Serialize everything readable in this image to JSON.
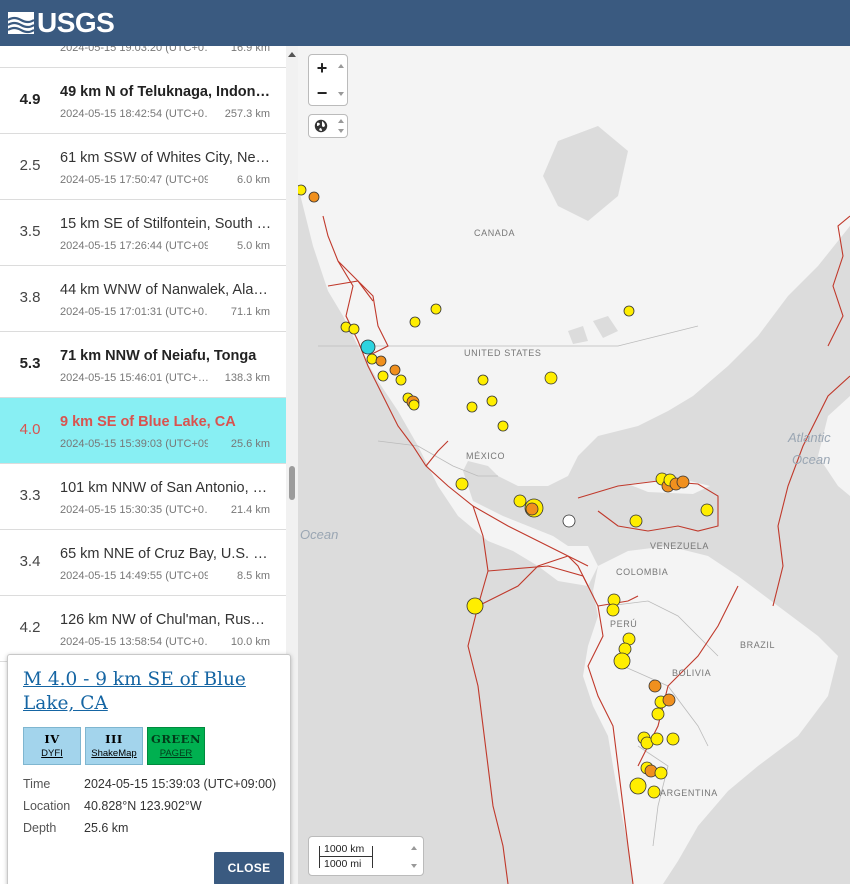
{
  "header": {
    "logo_text": "USGS"
  },
  "list": {
    "items": [
      {
        "mag": "",
        "place": "",
        "time": "2024-05-15 19:03:20 (UTC+0…",
        "depth": "16.9 km",
        "bold": false,
        "selected": false,
        "partial": true
      },
      {
        "mag": "4.9",
        "place": "49 km N of Teluknaga, Indon…",
        "time": "2024-05-15 18:42:54 (UTC+0…",
        "depth": "257.3 km",
        "bold": true,
        "selected": false
      },
      {
        "mag": "2.5",
        "place": "61 km SSW of Whites City, Ne…",
        "time": "2024-05-15 17:50:47 (UTC+09:…",
        "depth": "6.0 km",
        "bold": false,
        "selected": false
      },
      {
        "mag": "3.5",
        "place": "15 km SE of Stilfontein, South …",
        "time": "2024-05-15 17:26:44 (UTC+09:…",
        "depth": "5.0 km",
        "bold": false,
        "selected": false
      },
      {
        "mag": "3.8",
        "place": "44 km WNW of Nanwalek, Ala…",
        "time": "2024-05-15 17:01:31 (UTC+0…",
        "depth": "71.1 km",
        "bold": false,
        "selected": false
      },
      {
        "mag": "5.3",
        "place": "71 km NNW of Neiafu, Tonga",
        "time": "2024-05-15 15:46:01 (UTC+…",
        "depth": "138.3 km",
        "bold": true,
        "selected": false
      },
      {
        "mag": "4.0",
        "place": "9 km SE of Blue Lake, CA",
        "time": "2024-05-15 15:39:03 (UTC+09:00)",
        "depth": "25.6 km",
        "bold": false,
        "selected": true
      },
      {
        "mag": "3.3",
        "place": "101 km NNW of San Antonio, …",
        "time": "2024-05-15 15:30:35 (UTC+0…",
        "depth": "21.4 km",
        "bold": false,
        "selected": false
      },
      {
        "mag": "3.4",
        "place": "65 km NNE of Cruz Bay, U.S. V…",
        "time": "2024-05-15 14:49:55 (UTC+09:…",
        "depth": "8.5 km",
        "bold": false,
        "selected": false
      },
      {
        "mag": "4.2",
        "place": "126 km NW of Chul'man, Russ…",
        "time": "2024-05-15 13:58:54 (UTC+0…",
        "depth": "10.0 km",
        "bold": false,
        "selected": false
      }
    ]
  },
  "map": {
    "labels": {
      "canada": "CANADA",
      "united_states": "UNITED STATES",
      "mexico": "MÉXICO",
      "venezuela": "VENEZUELA",
      "colombia": "COLOMBIA",
      "peru": "PERÚ",
      "brazil": "BRAZIL",
      "bolivia": "BOLIVIA",
      "argentina": "ARGENTINA"
    },
    "ocean_labels": {
      "atlantic_1": "Atlantic",
      "atlantic_2": "Ocean",
      "pacific": "Ocean"
    },
    "zoom_in": "+",
    "zoom_out": "−",
    "scale_km": "1000 km",
    "scale_mi": "1000 mi",
    "colors": {
      "water": "#dcdcdc",
      "land": "#f4f4f4",
      "plate_boundary": "#c0392b",
      "quake_recent": "#ffee00",
      "quake_older": "#f0901e",
      "quake_selected": "#2dd4e0",
      "quake_white": "#ffffff"
    },
    "quakes": [
      {
        "color": "yellow"
      },
      {
        "color": "orange"
      },
      {
        "color": "yellow"
      },
      {
        "color": "yellow"
      },
      {
        "color": "cyan"
      },
      {
        "color": "yellow"
      },
      {
        "color": "orange"
      },
      {
        "color": "yellow"
      }
    ]
  },
  "popup": {
    "title": "M 4.0 - 9 km SE of Blue Lake, CA",
    "badges": [
      {
        "roman": "IV",
        "label": "DYFI",
        "color": "#a3d4ec"
      },
      {
        "roman": "III",
        "label": "ShakeMap",
        "color": "#a3d4ec"
      },
      {
        "roman": "GREEN",
        "label": "PAGER",
        "color": "#00b050"
      }
    ],
    "time_label": "Time",
    "time_value": "2024-05-15 15:39:03 (UTC+09:00)",
    "location_label": "Location",
    "location_value": "40.828°N 123.902°W",
    "depth_label": "Depth",
    "depth_value": "25.6 km",
    "close_label": "CLOSE"
  }
}
